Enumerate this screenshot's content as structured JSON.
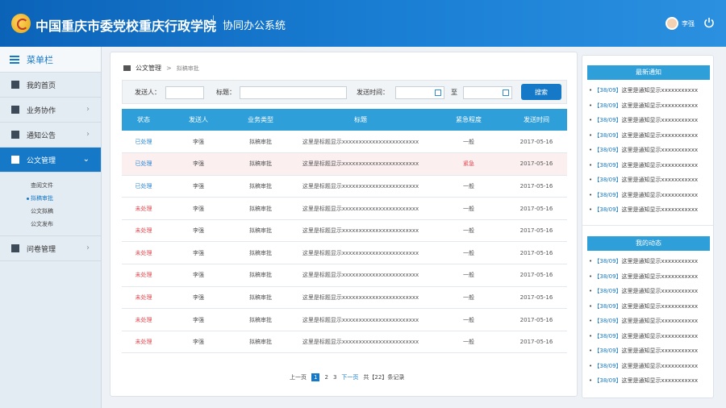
{
  "header": {
    "school_name": "中国重庆市委党校重庆行政学院",
    "system_name": "协同办公系统",
    "username": "李强"
  },
  "sidebar": {
    "title": "菜单栏",
    "items": [
      {
        "label": "我的首页",
        "icon": "home-icon"
      },
      {
        "label": "业务协作",
        "icon": "briefcase-icon"
      },
      {
        "label": "通知公告",
        "icon": "megaphone-icon"
      },
      {
        "label": "公文管理",
        "icon": "folder-icon"
      },
      {
        "label": "问卷管理",
        "icon": "survey-icon"
      }
    ],
    "submenu": [
      "查阅文件",
      "拟稿审批",
      "公文拟稿",
      "公文发布"
    ]
  },
  "breadcrumb": {
    "root": "公文管理",
    "current": "拟稿审批"
  },
  "filter": {
    "sender_label": "发送人：",
    "title_label": "标题：",
    "time_label": "发送时间：",
    "to_label": "至",
    "search_label": "搜索",
    "sender_value": "",
    "title_value": "",
    "date_from": "",
    "date_to": ""
  },
  "table": {
    "columns": [
      "状态",
      "发送人",
      "业务类型",
      "标题",
      "紧急程度",
      "发送时间"
    ],
    "rows": [
      {
        "status": "已处理",
        "sender": "李强",
        "type": "拟稿审批",
        "title": "这里是标题显示xxxxxxxxxxxxxxxxxxxxxxx",
        "urgency": "一般",
        "date": "2017-05-16"
      },
      {
        "status": "已处理",
        "sender": "李强",
        "type": "拟稿审批",
        "title": "这里是标题显示xxxxxxxxxxxxxxxxxxxxxxx",
        "urgency": "紧急",
        "date": "2017-05-16"
      },
      {
        "status": "已处理",
        "sender": "李强",
        "type": "拟稿审批",
        "title": "这里是标题显示xxxxxxxxxxxxxxxxxxxxxxx",
        "urgency": "一般",
        "date": "2017-05-16"
      },
      {
        "status": "未处理",
        "sender": "李强",
        "type": "拟稿审批",
        "title": "这里是标题显示xxxxxxxxxxxxxxxxxxxxxxx",
        "urgency": "一般",
        "date": "2017-05-16"
      },
      {
        "status": "未处理",
        "sender": "李强",
        "type": "拟稿审批",
        "title": "这里是标题显示xxxxxxxxxxxxxxxxxxxxxxx",
        "urgency": "一般",
        "date": "2017-05-16"
      },
      {
        "status": "未处理",
        "sender": "李强",
        "type": "拟稿审批",
        "title": "这里是标题显示xxxxxxxxxxxxxxxxxxxxxxx",
        "urgency": "一般",
        "date": "2017-05-16"
      },
      {
        "status": "未处理",
        "sender": "李强",
        "type": "拟稿审批",
        "title": "这里是标题显示xxxxxxxxxxxxxxxxxxxxxxx",
        "urgency": "一般",
        "date": "2017-05-16"
      },
      {
        "status": "未处理",
        "sender": "李强",
        "type": "拟稿审批",
        "title": "这里是标题显示xxxxxxxxxxxxxxxxxxxxxxx",
        "urgency": "一般",
        "date": "2017-05-16"
      },
      {
        "status": "未处理",
        "sender": "李强",
        "type": "拟稿审批",
        "title": "这里是标题显示xxxxxxxxxxxxxxxxxxxxxxx",
        "urgency": "一般",
        "date": "2017-05-16"
      },
      {
        "status": "未处理",
        "sender": "李强",
        "type": "拟稿审批",
        "title": "这里是标题显示xxxxxxxxxxxxxxxxxxxxxxx",
        "urgency": "一般",
        "date": "2017-05-16"
      }
    ]
  },
  "pager": {
    "prev": "上一页",
    "pages": [
      "1",
      "2",
      "3"
    ],
    "current": "1",
    "next": "下一页",
    "total": "共【22】条记录"
  },
  "notices": {
    "title": "最新通知",
    "items": [
      {
        "date": "【38/09】",
        "text": "这里是通知显示xxxxxxxxxxx"
      },
      {
        "date": "【38/09】",
        "text": "这里是通知显示xxxxxxxxxxx"
      },
      {
        "date": "【38/09】",
        "text": "这里是通知显示xxxxxxxxxxx"
      },
      {
        "date": "【38/09】",
        "text": "这里是通知显示xxxxxxxxxxx"
      },
      {
        "date": "【38/09】",
        "text": "这里是通知显示xxxxxxxxxxx"
      },
      {
        "date": "【38/09】",
        "text": "这里是通知显示xxxxxxxxxxx"
      },
      {
        "date": "【38/09】",
        "text": "这里是通知显示xxxxxxxxxxx"
      },
      {
        "date": "【38/09】",
        "text": "这里是通知显示xxxxxxxxxxx"
      },
      {
        "date": "【38/09】",
        "text": "这里是通知显示xxxxxxxxxxx"
      }
    ]
  },
  "activity": {
    "title": "我的动态",
    "items": [
      {
        "date": "【38/09】",
        "text": "这里是通知显示xxxxxxxxxxx"
      },
      {
        "date": "【38/09】",
        "text": "这里是通知显示xxxxxxxxxxx"
      },
      {
        "date": "【38/09】",
        "text": "这里是通知显示xxxxxxxxxxx"
      },
      {
        "date": "【38/09】",
        "text": "这里是通知显示xxxxxxxxxxx"
      },
      {
        "date": "【38/09】",
        "text": "这里是通知显示xxxxxxxxxxx"
      },
      {
        "date": "【38/09】",
        "text": "这里是通知显示xxxxxxxxxxx"
      },
      {
        "date": "【38/09】",
        "text": "这里是通知显示xxxxxxxxxxx"
      },
      {
        "date": "【38/09】",
        "text": "这里是通知显示xxxxxxxxxxx"
      },
      {
        "date": "【38/09】",
        "text": "这里是通知显示xxxxxxxxxxx"
      }
    ]
  },
  "colors": {
    "brand_blue": "#1679c8",
    "table_header": "#2e9fd8",
    "status_done": "#2b86d1",
    "status_todo": "#e0484f",
    "urgent_row_bg": "#fbeff0"
  }
}
